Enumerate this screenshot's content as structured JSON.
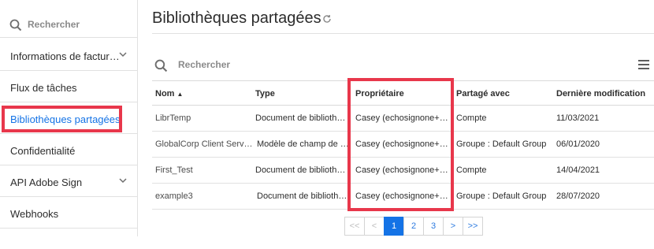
{
  "sidebar": {
    "search_placeholder": "Rechercher",
    "items": [
      {
        "label": "Informations de factur…",
        "has_chevron": true
      },
      {
        "label": "Flux de tâches",
        "has_chevron": false
      },
      {
        "label": "Bibliothèques partagées",
        "has_chevron": false,
        "active": true
      },
      {
        "label": "Confidentialité",
        "has_chevron": false
      },
      {
        "label": "API Adobe Sign",
        "has_chevron": true
      },
      {
        "label": "Webhooks",
        "has_chevron": false
      }
    ]
  },
  "main": {
    "title": "Bibliothèques partagées",
    "search_placeholder": "Rechercher",
    "columns": [
      "Nom",
      "Type",
      "Propriétaire",
      "Partagé avec",
      "Dernière modification"
    ],
    "sort": {
      "column": "Nom",
      "direction": "ascending"
    },
    "rows": [
      {
        "name": "LibrTemp",
        "type": "Document de bibliothè…",
        "owner": "Casey (echosignone+ne…",
        "shared": "Compte",
        "modified": "11/03/2021"
      },
      {
        "name": "GlobalCorp Client Servi…",
        "type": "Modèle de champ de f…",
        "owner": "Casey (echosignone+ne…",
        "shared": "Groupe : Default Group",
        "modified": "06/01/2020"
      },
      {
        "name": "First_Test",
        "type": "Document de bibliothè…",
        "owner": "Casey (echosignone+ne…",
        "shared": "Compte",
        "modified": "14/04/2021"
      },
      {
        "name": "example3",
        "type": "Document de bibliothè…",
        "owner": "Casey (echosignone+ne…",
        "shared": "Groupe : Default Group",
        "modified": "28/07/2020"
      }
    ]
  },
  "pagination": {
    "first": "<<",
    "prev": "<",
    "pages": [
      "1",
      "2",
      "3"
    ],
    "current": "1",
    "next": ">",
    "last": ">>"
  },
  "colors": {
    "accent": "#1473e6",
    "highlight": "#e8374b",
    "border": "#e1e1e1"
  }
}
